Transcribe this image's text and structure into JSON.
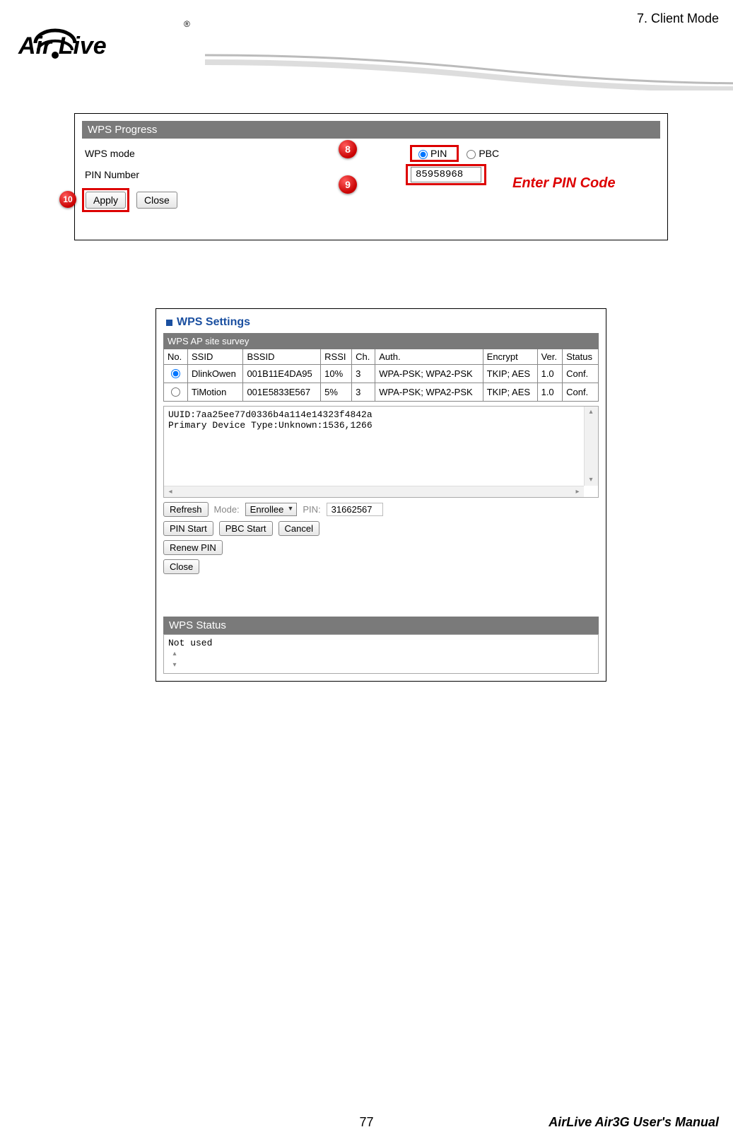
{
  "header": {
    "chapter": "7.  Client Mode",
    "logo_text": "Air Live",
    "logo_r": "®"
  },
  "shot1": {
    "title": "WPS Progress",
    "mode_label": "WPS mode",
    "pin_label": "PIN Number",
    "radio_pin": "PIN",
    "radio_pbc": "PBC",
    "pin_value": "85958968",
    "apply": "Apply",
    "close": "Close",
    "callout8": "8",
    "callout9": "9",
    "callout10": "10",
    "enter_pin": "Enter PIN Code"
  },
  "shot2": {
    "title": "WPS Settings",
    "survey_title": "WPS AP site survey",
    "cols": {
      "no": "No.",
      "ssid": "SSID",
      "bssid": "BSSID",
      "rssi": "RSSI",
      "ch": "Ch.",
      "auth": "Auth.",
      "encrypt": "Encrypt",
      "ver": "Ver.",
      "status": "Status"
    },
    "rows": [
      {
        "ssid": "DlinkOwen",
        "bssid": "001B11E4DA95",
        "rssi": "10%",
        "ch": "3",
        "auth": "WPA-PSK; WPA2-PSK",
        "encrypt": "TKIP; AES",
        "ver": "1.0",
        "status": "Conf."
      },
      {
        "ssid": "TiMotion",
        "bssid": "001E5833E567",
        "rssi": "5%",
        "ch": "3",
        "auth": "WPA-PSK; WPA2-PSK",
        "encrypt": "TKIP; AES",
        "ver": "1.0",
        "status": "Conf."
      }
    ],
    "uuid_line1": "UUID:7aa25ee77d0336b4a114e14323f4842a",
    "uuid_line2": "Primary Device Type:Unknown:1536,1266",
    "refresh": "Refresh",
    "mode_lbl": "Mode:",
    "mode_val": "Enrollee",
    "pin_lbl": "PIN:",
    "pin_val": "31662567",
    "pin_start": "PIN Start",
    "pbc_start": "PBC Start",
    "cancel": "Cancel",
    "renew": "Renew PIN",
    "close": "Close",
    "status_title": "WPS Status",
    "status_text": "Not used"
  },
  "footer": {
    "page": "77",
    "manual": "AirLive Air3G User's Manual"
  }
}
